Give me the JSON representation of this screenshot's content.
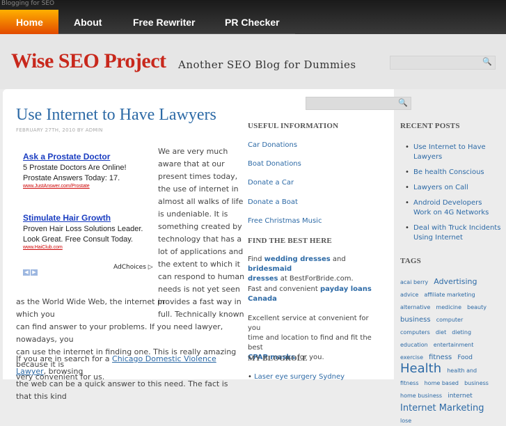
{
  "site": {
    "top_tagline": "Blogging for SEO",
    "title": "Wise SEO Project",
    "tagline": "Another SEO Blog for Dummies"
  },
  "nav": {
    "items": [
      "Home",
      "About",
      "Free Rewriter",
      "PR Checker"
    ]
  },
  "post": {
    "title": "Use Internet to Have Lawyers",
    "meta": "FEBRUARY 27TH, 2010 BY ADMIN",
    "col_lines": [
      "We are very much",
      "aware that at our",
      "present times today,",
      "the use of internet in",
      "almost all walks of life",
      "is undeniable. It is",
      "something created by",
      "technology that has a",
      "lot of applications and",
      "the extent to which it",
      "can respond to human",
      "needs is not yet seen in",
      "full. Technically known"
    ],
    "full_lines": [
      "as the World Wide Web, the internet provides a fast way in which you",
      "can find answer to your problems. If you need lawyer, nowadays, you",
      "can use the internet in finding one. This is really amazing because it is",
      "very convenient for us."
    ],
    "para2_before": "If you are in search for a ",
    "para2_link": "Chicago Domestic Violence Lawyer",
    "para2_after": ", browsing",
    "para2_line2": "the web can be a quick answer to this need. The fact is that this kind"
  },
  "ads": [
    {
      "title": "Ask a Prostate Doctor",
      "body": "5 Prostate Doctors Are Online! Prostate Answers Today: 17.",
      "url": "www.JustAnswer.com/Prostate"
    },
    {
      "title": "Stimulate Hair Growth",
      "body": "Proven Hair Loss Solutions Leader. Look Great. Free Consult Today.",
      "url": "www.HaiClub.com"
    }
  ],
  "adchoices": "AdChoices ▷",
  "useful": {
    "heading": "USEFUL INFORMATION",
    "links": [
      "Car Donations",
      "Boat Donations",
      "Donate a Car",
      "Donate a Boat",
      "Free Christmas Music"
    ]
  },
  "find_best": {
    "heading": "FIND THE BEST HERE",
    "p1_a": "Find ",
    "p1_l1": "wedding dresses",
    "p1_b": " and ",
    "p1_l2": "bridesmaid",
    "p1_l3": "dresses",
    "p1_c": " at BestForBride.com.",
    "p2_a": "Fast and convenient ",
    "p2_l1": "payday loans",
    "p2_l2": "Canada",
    "p3_a": "Excellent service at convenient for you",
    "p3_b": "time and location to find and fit the best",
    "p3_l1": "CPAP masks",
    "p3_c": " for you."
  },
  "blogroll": {
    "heading": "MY BLOGROLL",
    "items": [
      "Laser eye surgery Sydney"
    ]
  },
  "recent": {
    "heading": "RECENT POSTS",
    "items": [
      "Use Internet to Have Lawyers",
      "Be health Conscious",
      "Lawyers on Call",
      "Android Developers Work on 4G Networks",
      "Deal with Truck Incidents Using Internet"
    ]
  },
  "tags": {
    "heading": "TAGS",
    "items": [
      {
        "t": "acai berry",
        "s": 8
      },
      {
        "t": "Advertising",
        "s": 11
      },
      {
        "t": "advice",
        "s": 8
      },
      {
        "t": "affiliate marketing",
        "s": 8
      },
      {
        "t": "alternative",
        "s": 8
      },
      {
        "t": "medicine",
        "s": 8
      },
      {
        "t": "beauty",
        "s": 8
      },
      {
        "t": "business",
        "s": 10
      },
      {
        "t": "computer",
        "s": 8
      },
      {
        "t": "computers",
        "s": 8
      },
      {
        "t": "diet",
        "s": 8
      },
      {
        "t": "dieting",
        "s": 8
      },
      {
        "t": "education",
        "s": 8
      },
      {
        "t": "entertainment",
        "s": 8
      },
      {
        "t": "exercise",
        "s": 8
      },
      {
        "t": "fitness",
        "s": 10
      },
      {
        "t": "Food",
        "s": 9
      },
      {
        "t": "Health",
        "s": 18
      },
      {
        "t": "health and fitness",
        "s": 8
      },
      {
        "t": "home based",
        "s": 8
      },
      {
        "t": "business",
        "s": 8
      },
      {
        "t": "home business",
        "s": 8
      },
      {
        "t": "internet",
        "s": 9
      },
      {
        "t": "Internet Marketing",
        "s": 13
      },
      {
        "t": "lose",
        "s": 8
      }
    ]
  }
}
